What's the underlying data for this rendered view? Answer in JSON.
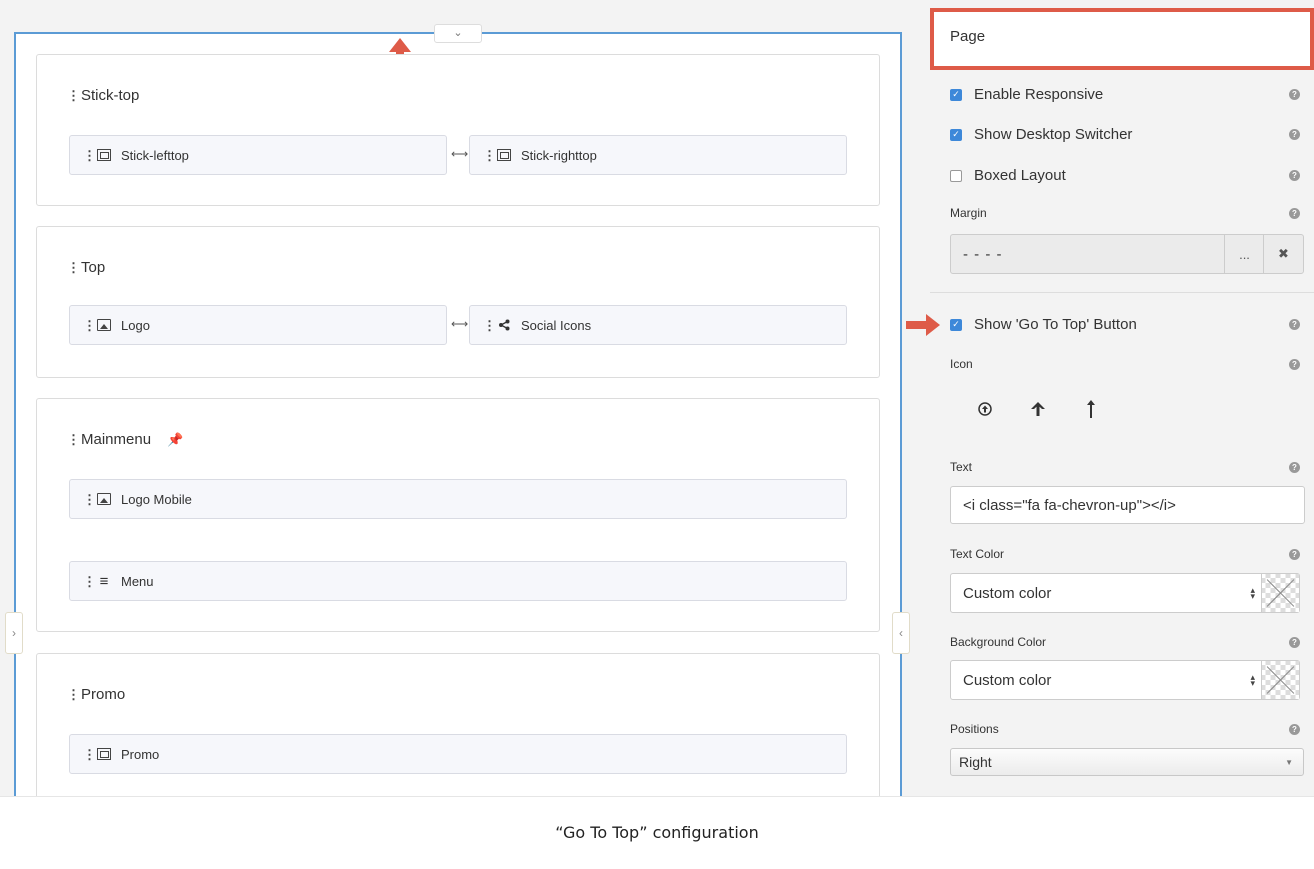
{
  "layout": {
    "sections": [
      {
        "title": "Stick-top",
        "blocks": [
          "Stick-lefttop",
          "Stick-righttop"
        ]
      },
      {
        "title": "Top",
        "blocks": [
          "Logo",
          "Social Icons"
        ]
      },
      {
        "title": "Mainmenu",
        "blocks": [
          "Logo Mobile",
          "Menu"
        ]
      },
      {
        "title": "Promo",
        "blocks": [
          "Promo"
        ]
      }
    ]
  },
  "panel": {
    "title": "Page",
    "enable_responsive": "Enable Responsive",
    "show_desktop_switcher": "Show Desktop Switcher",
    "boxed_layout": "Boxed Layout",
    "margin_label": "Margin",
    "margin_value": "- - - -",
    "margin_more": "...",
    "margin_clear": "✖",
    "go_to_top": "Show 'Go To Top' Button",
    "icon_label": "Icon",
    "text_label": "Text",
    "text_value": "<i class=\"fa fa-chevron-up\"></i>",
    "text_color_label": "Text Color",
    "text_color_value": "Custom color",
    "bg_color_label": "Background Color",
    "bg_color_value": "Custom color",
    "positions_label": "Positions",
    "positions_value": "Right",
    "checked": {
      "enable_responsive": true,
      "show_desktop_switcher": true,
      "boxed_layout": false,
      "go_to_top": true
    }
  },
  "caption": "“Go To Top” configuration",
  "colors": {
    "accent_blue": "#3d88d9",
    "highlight_red": "#de5b48",
    "pin": "#f0a92d"
  }
}
